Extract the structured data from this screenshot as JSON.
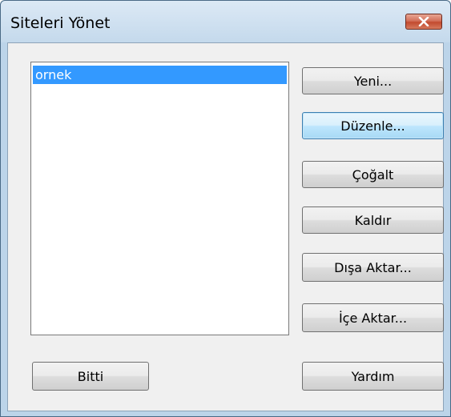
{
  "window": {
    "title": "Siteleri Yönet",
    "close_icon": "close-icon"
  },
  "sites_list": {
    "items": [
      "ornek"
    ],
    "selected_index": 0
  },
  "buttons": {
    "new": "Yeni...",
    "edit": "Düzenle...",
    "duplicate": "Çoğalt",
    "remove": "Kaldır",
    "export": "Dışa Aktar...",
    "import": "İçe Aktar...",
    "done": "Bitti",
    "help": "Yardım"
  },
  "colors": {
    "selection": "#3399ff",
    "close_button": "#c24a2f",
    "focused_button_border": "#3c7fb1"
  }
}
